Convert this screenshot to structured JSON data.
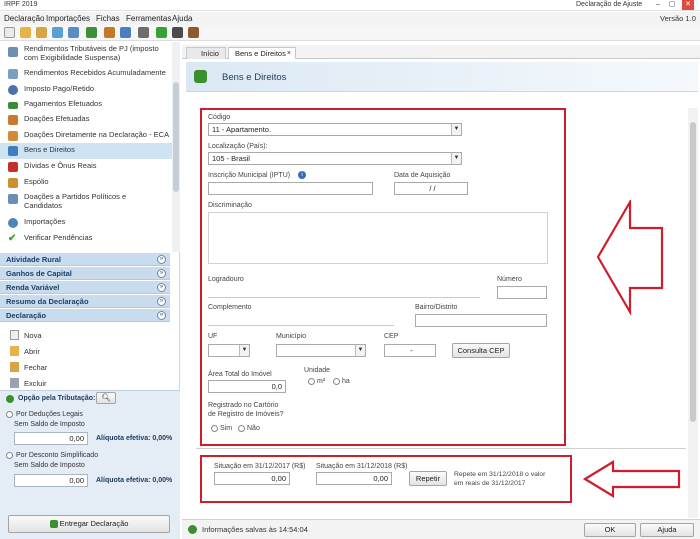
{
  "window": {
    "title": "IRPF 2019",
    "right_items": [
      "Declaração de Ajuste",
      "Versão 1.0"
    ]
  },
  "menu": [
    "Declaração",
    "Importações",
    "Fichas",
    "Ferramentas",
    "Ajuda"
  ],
  "sidebar": {
    "items": [
      {
        "label": "Rendimentos Tributáveis de PJ (imposto",
        "label2": "com Exigibilidade Suspensa)",
        "icon": "document-icon",
        "color": "#6d8fb3"
      },
      {
        "label": "Rendimentos Recebidos Acumuladamente",
        "icon": "document-icon",
        "color": "#7a9fc3"
      },
      {
        "label": "Imposto Pago/Retido",
        "icon": "coin-icon",
        "color": "#4a74a8"
      },
      {
        "label": "Pagamentos Efetuados",
        "icon": "money-icon",
        "color": "#3f8a3a"
      },
      {
        "label": "Doações Efetuadas",
        "icon": "gift-icon",
        "color": "#c97a2f"
      },
      {
        "label": "Doações Diretamente na Declaração - ECA",
        "icon": "gift-icon",
        "color": "#d08a38"
      },
      {
        "label": "Bens e Direitos",
        "icon": "house-icon",
        "color": "#3d7fc1",
        "active": true
      },
      {
        "label": "Dívidas e Ônus Reais",
        "icon": "arrow-down-icon",
        "color": "#c5302b"
      },
      {
        "label": "Espólio",
        "icon": "folder-icon",
        "color": "#c9922d"
      },
      {
        "label": "Doações a Partidos Políticos e",
        "label2": "Candidatos",
        "icon": "people-icon",
        "color": "#6a8fb5"
      },
      {
        "label": "Importações",
        "icon": "globe-icon",
        "color": "#4f86b7"
      },
      {
        "label": "Verificar Pendências",
        "icon": "checkmark-icon",
        "color": "#3aa53a"
      }
    ],
    "sections": [
      "Atividade Rural",
      "Ganhos de Capital",
      "Renda Variável",
      "Resumo da Declaração",
      "Declaração"
    ],
    "declaracao_items": [
      "Nova",
      "Abrir",
      "Fechar",
      "Excluir"
    ]
  },
  "opcao": {
    "title": "Opção pela Tributação:",
    "option1": "Por Deduções Legais",
    "saldo1_label": "Sem Saldo de Imposto",
    "saldo1_value": "0,00",
    "aliq1_label": "Alíquota efetiva: 0,00%",
    "option2": "Por Desconto Simplificado",
    "saldo2_label": "Sem Saldo de Imposto",
    "saldo2_value": "0,00",
    "aliq2_label": "Alíquota efetiva: 0,00%",
    "entregar_label": "Entregar Declaração"
  },
  "tabs": [
    {
      "label": "Início",
      "active": false
    },
    {
      "label": "Bens e Direitos",
      "active": true
    }
  ],
  "page": {
    "title": "Bens e Direitos"
  },
  "form": {
    "codigo_label": "Código",
    "codigo_value": "11 - Apartamento.",
    "localizacao_label": "Localização (País):",
    "localizacao_value": "105 - Brasil",
    "inscricao_label": "Inscrição Municipal (IPTU)",
    "data_label": "Data de Aquisição",
    "data_value": "/ /",
    "discriminacao_label": "Discriminação",
    "logradouro_label": "Logradouro",
    "numero_label": "Número",
    "complemento_label": "Complemento",
    "bairro_label": "Bairro/Distrito",
    "uf_label": "UF",
    "municipio_label": "Município",
    "cep_label": "CEP",
    "cep_value": "-",
    "consulta_cep_label": "Consulta CEP",
    "area_label": "Área Total do Imóvel",
    "area_value": "0,0",
    "unidade_label": "Unidade",
    "unidade_m2": "m²",
    "unidade_ha": "ha",
    "registrado_label": "Registrado no Cartório",
    "registrado_label2": "de Registro de Imóveis?",
    "sim_label": "Sim",
    "nao_label": "Não",
    "situacao2017_label": "Situação em 31/12/2017 (R$)",
    "situacao2017_value": "0,00",
    "situacao2018_label": "Situação em 31/12/2018 (R$)",
    "situacao2018_value": "0,00",
    "repetir_label": "Repetir",
    "repete_text": "Repete em 31/12/2018 o valor",
    "repete_text2": "em reais de 31/12/2017"
  },
  "status": {
    "saved_text": "Informações salvas às 14:54:04",
    "ok_label": "OK",
    "ajuda_label": "Ajuda"
  },
  "colors": {
    "annotation_red": "#cc1f2b",
    "sidebar_section": "#c9dcef",
    "accent_green": "#3a8f2e"
  }
}
